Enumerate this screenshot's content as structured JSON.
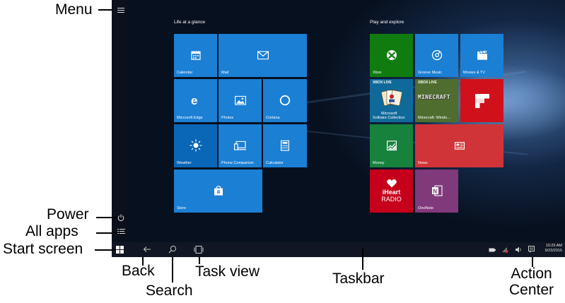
{
  "annotations": {
    "menu": "Menu",
    "power": "Power",
    "all_apps": "All apps",
    "start_screen": "Start screen",
    "back": "Back",
    "search": "Search",
    "task_view": "Task view",
    "taskbar": "Taskbar",
    "action_center_line1": "Action",
    "action_center_line2": "Center"
  },
  "groups": {
    "life": "Life at a glance",
    "play": "Play and explore"
  },
  "tiles": {
    "calendar": "Calendar",
    "mail": "Mail",
    "edge": "Microsoft Edge",
    "photos": "Photos",
    "cortana": "Cortana",
    "weather": "Weather",
    "phone_companion": "Phone Companion",
    "calculator": "Calculator",
    "store": "Store",
    "xbox": "Xbox",
    "groove": "Groove Music",
    "movies": "Movies & TV",
    "solitaire_badge": "XBOX LIVE",
    "solitaire_line1": "Microsoft",
    "solitaire_line2": "Solitaire Collection",
    "minecraft_badge": "XBOX LIVE",
    "minecraft_logo": "MINECRAFT",
    "minecraft": "Minecraft: Windo...",
    "money": "Money",
    "news": "News",
    "iheart_line1": "iHeart",
    "iheart_line2": "RADIO",
    "onenote": "OneNote"
  },
  "clock": {
    "time": "10:25 AM",
    "date": "9/23/2015"
  },
  "colors": {
    "tile_blue": "#1b7fd4",
    "tile_blue_dark": "#0a66b6",
    "xbox_green": "#107c10",
    "money_green": "#16823c",
    "news_red": "#d13438",
    "flipboard_red": "#d0111b",
    "iheart_red": "#c6001b",
    "onenote_purple": "#80397b",
    "taskbar": "#101623"
  },
  "icons": [
    "hamburger-menu-icon",
    "power-icon",
    "all-apps-icon",
    "windows-logo-icon",
    "back-arrow-icon",
    "search-icon",
    "task-view-icon",
    "battery-icon",
    "network-icon",
    "volume-icon",
    "action-center-icon"
  ]
}
